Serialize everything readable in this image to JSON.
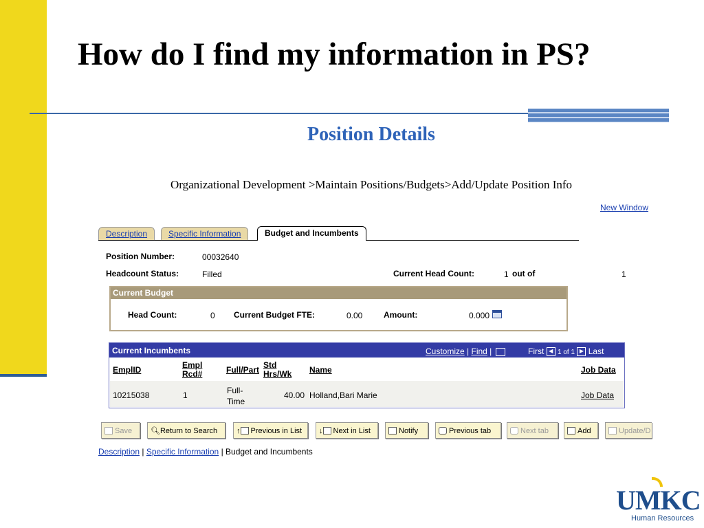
{
  "slide": {
    "title": "How do I find my information in PS?",
    "subtitle": "Position Details",
    "path": "Organizational Development >Maintain Positions/Budgets>Add/Update Position Info"
  },
  "header": {
    "new_window": "New Window"
  },
  "tabs": [
    {
      "label": "Description",
      "active": false
    },
    {
      "label": "Specific Information",
      "active": false
    },
    {
      "label": "Budget and Incumbents",
      "active": true
    }
  ],
  "position": {
    "number_label": "Position Number:",
    "number": "00032640",
    "status_label": "Headcount Status:",
    "status": "Filled",
    "head_count_label": "Current Head Count:",
    "head_count": "1",
    "out_of_label": "out of",
    "out_of": "1"
  },
  "budget": {
    "title": "Current Budget",
    "head_count_label": "Head Count:",
    "head_count": "0",
    "fte_label": "Current Budget FTE:",
    "fte": "0.00",
    "amount_label": "Amount:",
    "amount": "0.000"
  },
  "incumbents": {
    "title": "Current Incumbents",
    "customize": "Customize",
    "find": "Find",
    "first": "First",
    "range": "1 of 1",
    "last": "Last",
    "columns": {
      "emplid": "EmplID",
      "empl_rcd_1": "Empl",
      "empl_rcd_2": "Rcd#",
      "full_part": "Full/Part",
      "std_hrs_1": "Std",
      "std_hrs_2": "Hrs/Wk",
      "name": "Name",
      "job_data": "Job Data"
    },
    "rows": [
      {
        "emplid": "10215038",
        "rcd": "1",
        "full_part_1": "Full-",
        "full_part_2": "Time",
        "std_hrs": "40.00",
        "name": "Holland,Bari Marie",
        "job_data": "Job Data"
      }
    ]
  },
  "buttons": [
    {
      "label": "Save",
      "enabled": false,
      "icon": "save-icon"
    },
    {
      "label": "Return to Search",
      "enabled": true,
      "icon": "search-icon"
    },
    {
      "label": "Previous in List",
      "enabled": true,
      "icon": "previous-in-list-icon"
    },
    {
      "label": "Next in List",
      "enabled": true,
      "icon": "next-in-list-icon"
    },
    {
      "label": "Notify",
      "enabled": true,
      "icon": "notify-icon"
    },
    {
      "label": "Previous tab",
      "enabled": true,
      "icon": "previous-tab-icon"
    },
    {
      "label": "Next tab",
      "enabled": false,
      "icon": "next-tab-icon"
    },
    {
      "label": "Add",
      "enabled": true,
      "icon": "add-icon"
    },
    {
      "label": "Update/D",
      "enabled": false,
      "icon": "update-icon"
    }
  ],
  "bottom_links": {
    "description": "Description",
    "specific": "Specific Information",
    "budget": "Budget and Incumbents",
    "sep": "|"
  },
  "logo": {
    "text": "UMKC",
    "sub": "Human Resources"
  },
  "colors": {
    "accent_yellow": "#f0d81c",
    "title_blue": "#2e63b8",
    "grid_header": "#333ba5",
    "link_blue": "#1a3fb0"
  }
}
